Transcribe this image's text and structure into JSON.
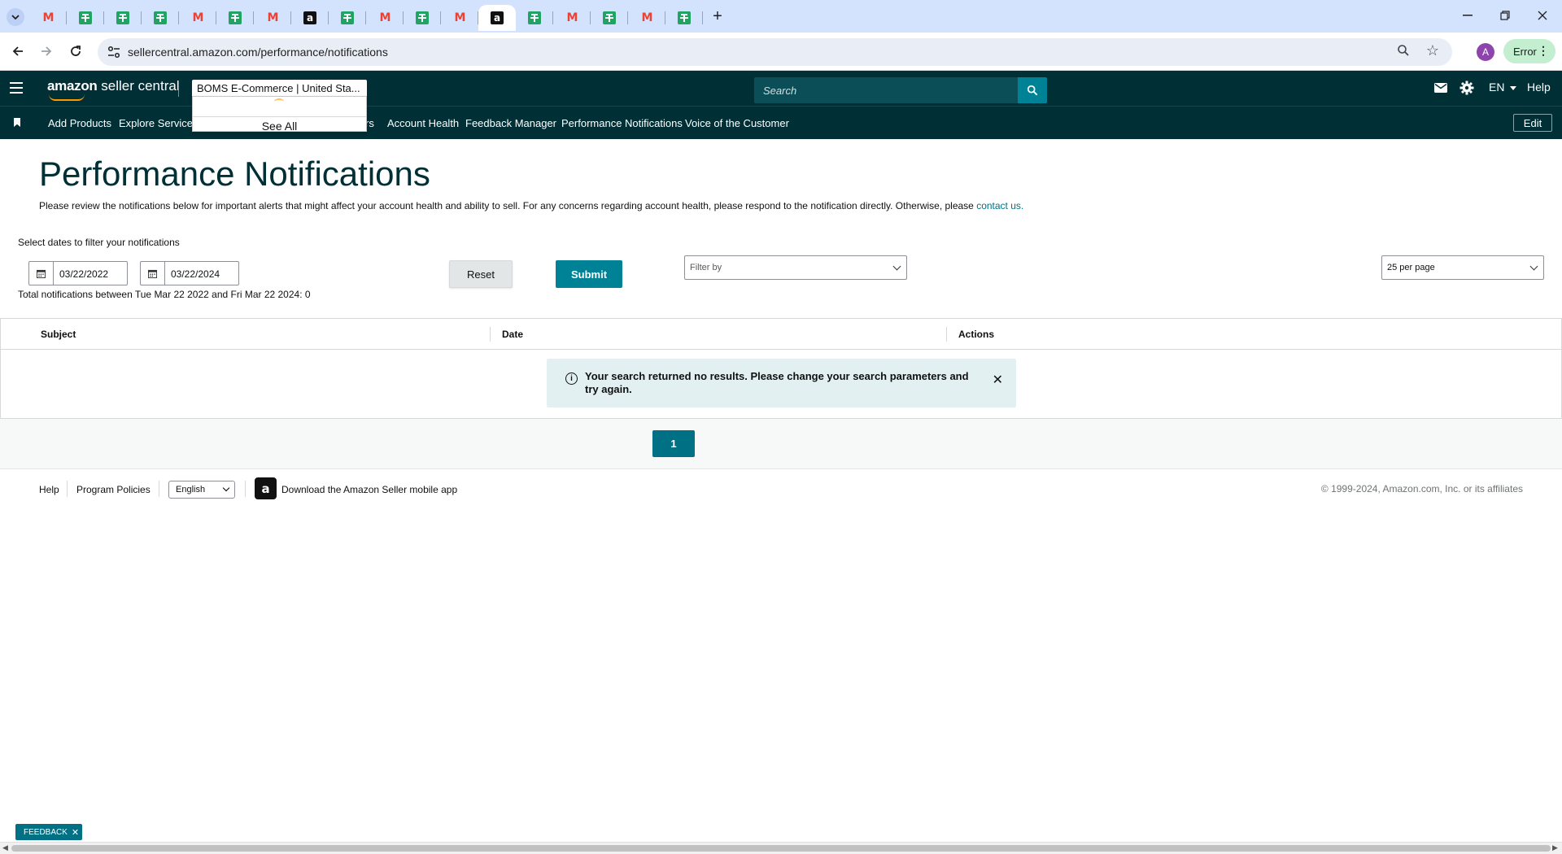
{
  "browser": {
    "tabs": [
      {
        "icon": "gmail-icon"
      },
      {
        "icon": "sheets-icon"
      },
      {
        "icon": "sheets-icon"
      },
      {
        "icon": "sheets-icon"
      },
      {
        "icon": "gmail-icon"
      },
      {
        "icon": "sheets-icon"
      },
      {
        "icon": "gmail-icon"
      },
      {
        "icon": "amazon-icon"
      },
      {
        "icon": "sheets-icon"
      },
      {
        "icon": "gmail-icon"
      },
      {
        "icon": "sheets-icon"
      },
      {
        "icon": "gmail-icon"
      },
      {
        "icon": "amazon-icon",
        "active": true
      },
      {
        "icon": "sheets-icon"
      },
      {
        "icon": "gmail-icon"
      },
      {
        "icon": "sheets-icon"
      },
      {
        "icon": "gmail-icon"
      },
      {
        "icon": "sheets-icon"
      }
    ],
    "url": "sellercentral.amazon.com/performance/notifications",
    "profile_initial": "A",
    "error_label": "Error"
  },
  "header": {
    "logo_brand": "amazon",
    "logo_product": "seller central",
    "account_name": "BOMS E-Commerce",
    "account_region": "United Sta...",
    "search_placeholder": "Search",
    "language": "EN",
    "help": "Help",
    "account_dropdown": {
      "see_all": "See All"
    }
  },
  "nav": {
    "items": [
      {
        "label": "Add Products"
      },
      {
        "label": "Explore Services"
      },
      {
        "label": "rs"
      },
      {
        "label": "Account Health"
      },
      {
        "label": "Feedback Manager"
      },
      {
        "label": "Performance Notifications"
      },
      {
        "label": "Voice of the Customer"
      }
    ],
    "edit": "Edit"
  },
  "main": {
    "title": "Performance Notifications",
    "intro": "Please review the notifications below for important alerts that might affect your account health and ability to sell. For any concerns regarding account health, please respond to the notification directly. Otherwise, please",
    "intro_link": "contact us.",
    "dates_label": "Select dates to filter your notifications",
    "start_date": "03/22/2022",
    "end_date": "03/22/2024",
    "total_text": "Total notifications between Tue Mar 22 2022 and Fri Mar 22 2024: 0",
    "reset": "Reset",
    "submit": "Submit",
    "filter_placeholder": "Filter by",
    "per_page": "25 per page",
    "table": {
      "columns": [
        "Subject",
        "Date",
        "Actions"
      ],
      "empty_message": "Your search returned no results. Please change your search parameters and try again."
    },
    "pagination": {
      "current_page": "1"
    }
  },
  "footer": {
    "help": "Help",
    "policies": "Program Policies",
    "language": "English",
    "app_text": "Download the Amazon Seller mobile app",
    "copyright": "© 1999-2024, Amazon.com, Inc. or its affiliates"
  },
  "feedback": "FEEDBACK",
  "colors": {
    "header_bg": "#002f36",
    "accent": "#008296",
    "page_button": "#007185",
    "tabstrip": "#d3e3fd"
  }
}
